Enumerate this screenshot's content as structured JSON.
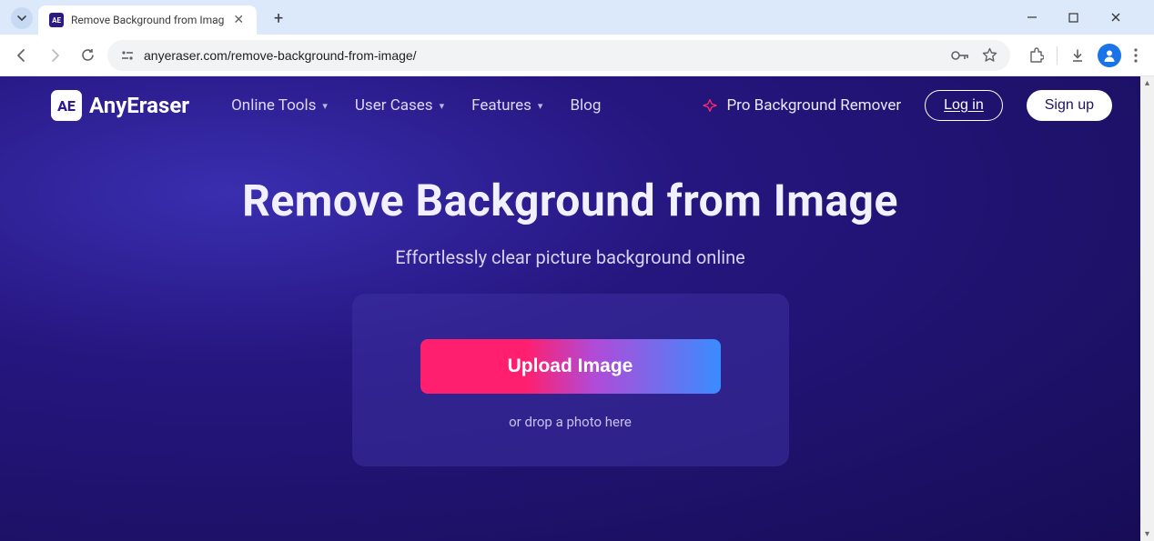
{
  "browser": {
    "tab": {
      "favicon_text": "AE",
      "title": "Remove Background from Imag"
    },
    "url": "anyeraser.com/remove-background-from-image/"
  },
  "site": {
    "logo_mark": "AE",
    "logo_text": "AnyEraser",
    "nav": {
      "online_tools": "Online Tools",
      "user_cases": "User Cases",
      "features": "Features",
      "blog": "Blog"
    },
    "pro_label": "Pro Background Remover",
    "login_label": "Log in",
    "signup_label": "Sign up"
  },
  "hero": {
    "title": "Remove Background from Image",
    "subtitle": "Effortlessly clear picture background online"
  },
  "dropzone": {
    "button_label": "Upload Image",
    "hint": "or drop a photo here"
  }
}
